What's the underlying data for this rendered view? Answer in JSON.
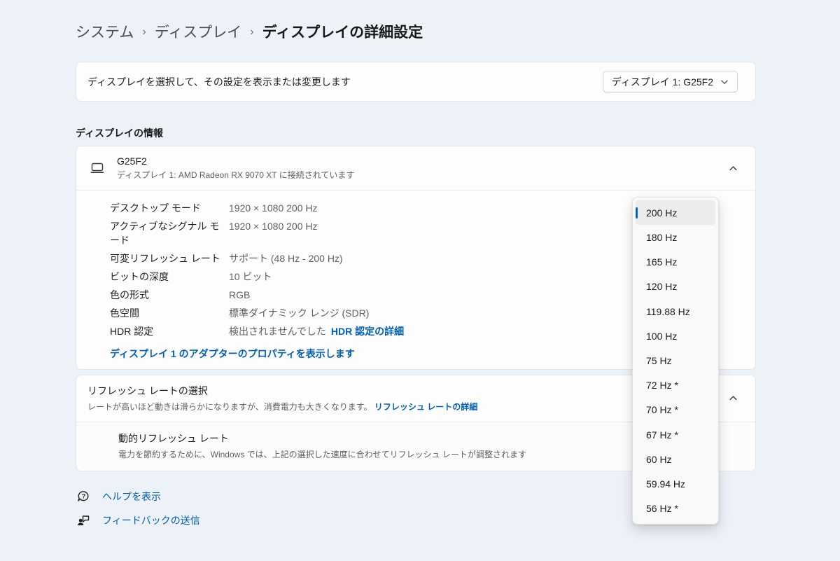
{
  "breadcrumb": {
    "items": [
      "システム",
      "ディスプレイ",
      "ディスプレイの詳細設定"
    ],
    "separator": "›"
  },
  "selector_card": {
    "label": "ディスプレイを選択して、その設定を表示または変更します",
    "dropdown_value": "ディスプレイ 1: G25F2"
  },
  "display_info": {
    "section_title": "ディスプレイの情報",
    "device_name": "G25F2",
    "device_subtitle": "ディスプレイ 1: AMD Radeon RX 9070 XT に接続されています",
    "properties": [
      {
        "label": "デスクトップ モード",
        "value": "1920 × 1080 200 Hz"
      },
      {
        "label": "アクティブなシグナル モード",
        "value": "1920 × 1080 200 Hz"
      },
      {
        "label": "可変リフレッシュ レート",
        "value": "サポート (48 Hz - 200 Hz)"
      },
      {
        "label": "ビットの深度",
        "value": "10 ビット"
      },
      {
        "label": "色の形式",
        "value": "RGB"
      },
      {
        "label": "色空間",
        "value": "標準ダイナミック レンジ (SDR)"
      },
      {
        "label": "HDR 認定",
        "value": "検出されませんでした",
        "link": "HDR 認定の詳細"
      }
    ],
    "adapter_link": "ディスプレイ 1 のアダプターのプロパティを表示します"
  },
  "refresh_rate": {
    "title": "リフレッシュ レートの選択",
    "description": "レートが高いほど動きは滑らかになりますが、消費電力も大きくなります。",
    "link": "リフレッシュ レートの詳細",
    "dynamic": {
      "title": "動的リフレッシュ レート",
      "description": "電力を節約するために、Windows では、上記の選択した速度に合わせてリフレッシュ レートが調整されます"
    }
  },
  "dropdown": {
    "options": [
      "200 Hz",
      "180 Hz",
      "165 Hz",
      "120 Hz",
      "119.88 Hz",
      "100 Hz",
      "75 Hz",
      "72 Hz *",
      "70 Hz *",
      "67 Hz *",
      "60 Hz",
      "59.94 Hz",
      "56 Hz *"
    ],
    "selected_index": 0
  },
  "footer": {
    "help": "ヘルプを表示",
    "feedback": "フィードバックの送信"
  },
  "colors": {
    "accent": "#0067c0",
    "link": "#005fb8",
    "page_background": "#edf1f8"
  }
}
